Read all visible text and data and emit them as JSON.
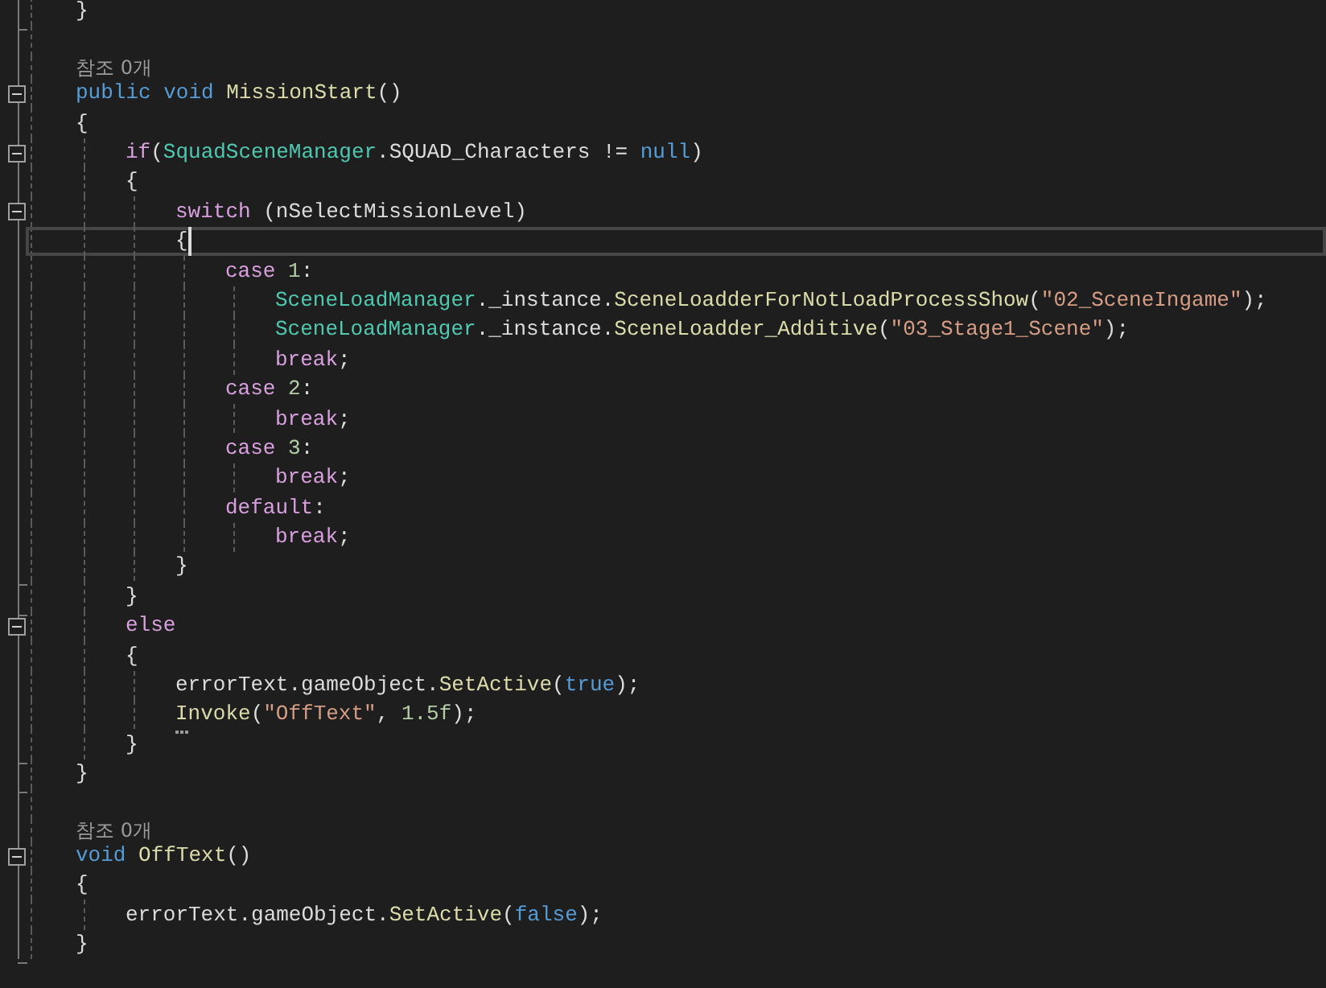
{
  "editor": {
    "lines": [
      {
        "kind": "code",
        "fold_end": true,
        "tokens": [
          {
            "text": "}",
            "kind": "plain"
          }
        ]
      },
      {
        "kind": "blank"
      },
      {
        "kind": "lens",
        "text": "참조 0개"
      },
      {
        "kind": "code",
        "foldable": true,
        "tokens": [
          {
            "text": "public void ",
            "kind": "keyword"
          },
          {
            "text": "MissionStart",
            "kind": "method"
          },
          {
            "text": "()",
            "kind": "plain"
          }
        ]
      },
      {
        "kind": "code",
        "tokens": [
          {
            "text": "{",
            "kind": "plain"
          }
        ],
        "children": [
          {
            "kind": "code",
            "foldable": true,
            "tokens": [
              {
                "text": "if",
                "kind": "control"
              },
              {
                "text": "(",
                "kind": "plain"
              },
              {
                "text": "SquadSceneManager",
                "kind": "type"
              },
              {
                "text": ".SQUAD_Characters != ",
                "kind": "plain"
              },
              {
                "text": "null",
                "kind": "keyword"
              },
              {
                "text": ")",
                "kind": "plain"
              }
            ]
          },
          {
            "kind": "code",
            "tokens": [
              {
                "text": "{",
                "kind": "plain"
              }
            ],
            "children": [
              {
                "kind": "code",
                "foldable": true,
                "tokens": [
                  {
                    "text": "switch",
                    "kind": "control"
                  },
                  {
                    "text": " (nSelectMissionLevel)",
                    "kind": "plain"
                  }
                ]
              },
              {
                "kind": "code",
                "current": true,
                "tokens": [
                  {
                    "text": "{",
                    "kind": "plain"
                  }
                ],
                "children": [
                  {
                    "kind": "code",
                    "tokens": [
                      {
                        "text": "case ",
                        "kind": "control"
                      },
                      {
                        "text": "1",
                        "kind": "number"
                      },
                      {
                        "text": ":",
                        "kind": "plain"
                      }
                    ],
                    "children": [
                      {
                        "kind": "code",
                        "tokens": [
                          {
                            "text": "SceneLoadManager",
                            "kind": "type"
                          },
                          {
                            "text": "._instance.",
                            "kind": "plain"
                          },
                          {
                            "text": "SceneLoadderForNotLoadProcessShow",
                            "kind": "method"
                          },
                          {
                            "text": "(",
                            "kind": "plain"
                          },
                          {
                            "text": "\"02_SceneIngame\"",
                            "kind": "string"
                          },
                          {
                            "text": ");",
                            "kind": "plain"
                          }
                        ]
                      },
                      {
                        "kind": "code",
                        "tokens": [
                          {
                            "text": "SceneLoadManager",
                            "kind": "type"
                          },
                          {
                            "text": "._instance.",
                            "kind": "plain"
                          },
                          {
                            "text": "SceneLoadder_Additive",
                            "kind": "method"
                          },
                          {
                            "text": "(",
                            "kind": "plain"
                          },
                          {
                            "text": "\"03_Stage1_Scene\"",
                            "kind": "string"
                          },
                          {
                            "text": ");",
                            "kind": "plain"
                          }
                        ]
                      },
                      {
                        "kind": "code",
                        "tokens": [
                          {
                            "text": "break",
                            "kind": "control"
                          },
                          {
                            "text": ";",
                            "kind": "plain"
                          }
                        ]
                      }
                    ]
                  },
                  {
                    "kind": "code",
                    "tokens": [
                      {
                        "text": "case ",
                        "kind": "control"
                      },
                      {
                        "text": "2",
                        "kind": "number"
                      },
                      {
                        "text": ":",
                        "kind": "plain"
                      }
                    ],
                    "children": [
                      {
                        "kind": "code",
                        "tokens": [
                          {
                            "text": "break",
                            "kind": "control"
                          },
                          {
                            "text": ";",
                            "kind": "plain"
                          }
                        ]
                      }
                    ]
                  },
                  {
                    "kind": "code",
                    "tokens": [
                      {
                        "text": "case ",
                        "kind": "control"
                      },
                      {
                        "text": "3",
                        "kind": "number"
                      },
                      {
                        "text": ":",
                        "kind": "plain"
                      }
                    ],
                    "children": [
                      {
                        "kind": "code",
                        "tokens": [
                          {
                            "text": "break",
                            "kind": "control"
                          },
                          {
                            "text": ";",
                            "kind": "plain"
                          }
                        ]
                      }
                    ]
                  },
                  {
                    "kind": "code",
                    "tokens": [
                      {
                        "text": "default",
                        "kind": "control"
                      },
                      {
                        "text": ":",
                        "kind": "plain"
                      }
                    ],
                    "children": [
                      {
                        "kind": "code",
                        "tokens": [
                          {
                            "text": "break",
                            "kind": "control"
                          },
                          {
                            "text": ";",
                            "kind": "plain"
                          }
                        ]
                      }
                    ]
                  }
                ]
              },
              {
                "kind": "code",
                "fold_end": true,
                "tokens": [
                  {
                    "text": "}",
                    "kind": "plain"
                  }
                ]
              }
            ]
          },
          {
            "kind": "code",
            "fold_end": true,
            "tokens": [
              {
                "text": "}",
                "kind": "plain"
              }
            ]
          },
          {
            "kind": "code",
            "foldable": true,
            "tokens": [
              {
                "text": "else",
                "kind": "control"
              }
            ]
          },
          {
            "kind": "code",
            "tokens": [
              {
                "text": "{",
                "kind": "plain"
              }
            ],
            "children": [
              {
                "kind": "code",
                "tokens": [
                  {
                    "text": "errorText.gameObject.",
                    "kind": "plain"
                  },
                  {
                    "text": "SetActive",
                    "kind": "method"
                  },
                  {
                    "text": "(",
                    "kind": "plain"
                  },
                  {
                    "text": "true",
                    "kind": "keyword"
                  },
                  {
                    "text": ");",
                    "kind": "plain"
                  }
                ]
              },
              {
                "kind": "code",
                "suggestion": true,
                "tokens": [
                  {
                    "text": "Invoke",
                    "kind": "method"
                  },
                  {
                    "text": "(",
                    "kind": "plain"
                  },
                  {
                    "text": "\"OffText\"",
                    "kind": "string"
                  },
                  {
                    "text": ", ",
                    "kind": "plain"
                  },
                  {
                    "text": "1.5f",
                    "kind": "number"
                  },
                  {
                    "text": ");",
                    "kind": "plain"
                  }
                ]
              }
            ]
          },
          {
            "kind": "code",
            "fold_end": true,
            "tokens": [
              {
                "text": "}",
                "kind": "plain"
              }
            ]
          }
        ]
      },
      {
        "kind": "code",
        "fold_end": true,
        "tokens": [
          {
            "text": "}",
            "kind": "plain"
          }
        ]
      },
      {
        "kind": "blank"
      },
      {
        "kind": "lens",
        "text": "참조 0개"
      },
      {
        "kind": "code",
        "foldable": true,
        "tokens": [
          {
            "text": "void ",
            "kind": "keyword"
          },
          {
            "text": "OffText",
            "kind": "method"
          },
          {
            "text": "()",
            "kind": "plain"
          }
        ]
      },
      {
        "kind": "code",
        "tokens": [
          {
            "text": "{",
            "kind": "plain"
          }
        ],
        "children": [
          {
            "kind": "code",
            "tokens": [
              {
                "text": "errorText.gameObject.",
                "kind": "plain"
              },
              {
                "text": "SetActive",
                "kind": "method"
              },
              {
                "text": "(",
                "kind": "plain"
              },
              {
                "text": "false",
                "kind": "keyword"
              },
              {
                "text": ");",
                "kind": "plain"
              }
            ]
          }
        ]
      },
      {
        "kind": "code",
        "fold_end": true,
        "tokens": [
          {
            "text": "}",
            "kind": "plain"
          }
        ]
      }
    ]
  }
}
